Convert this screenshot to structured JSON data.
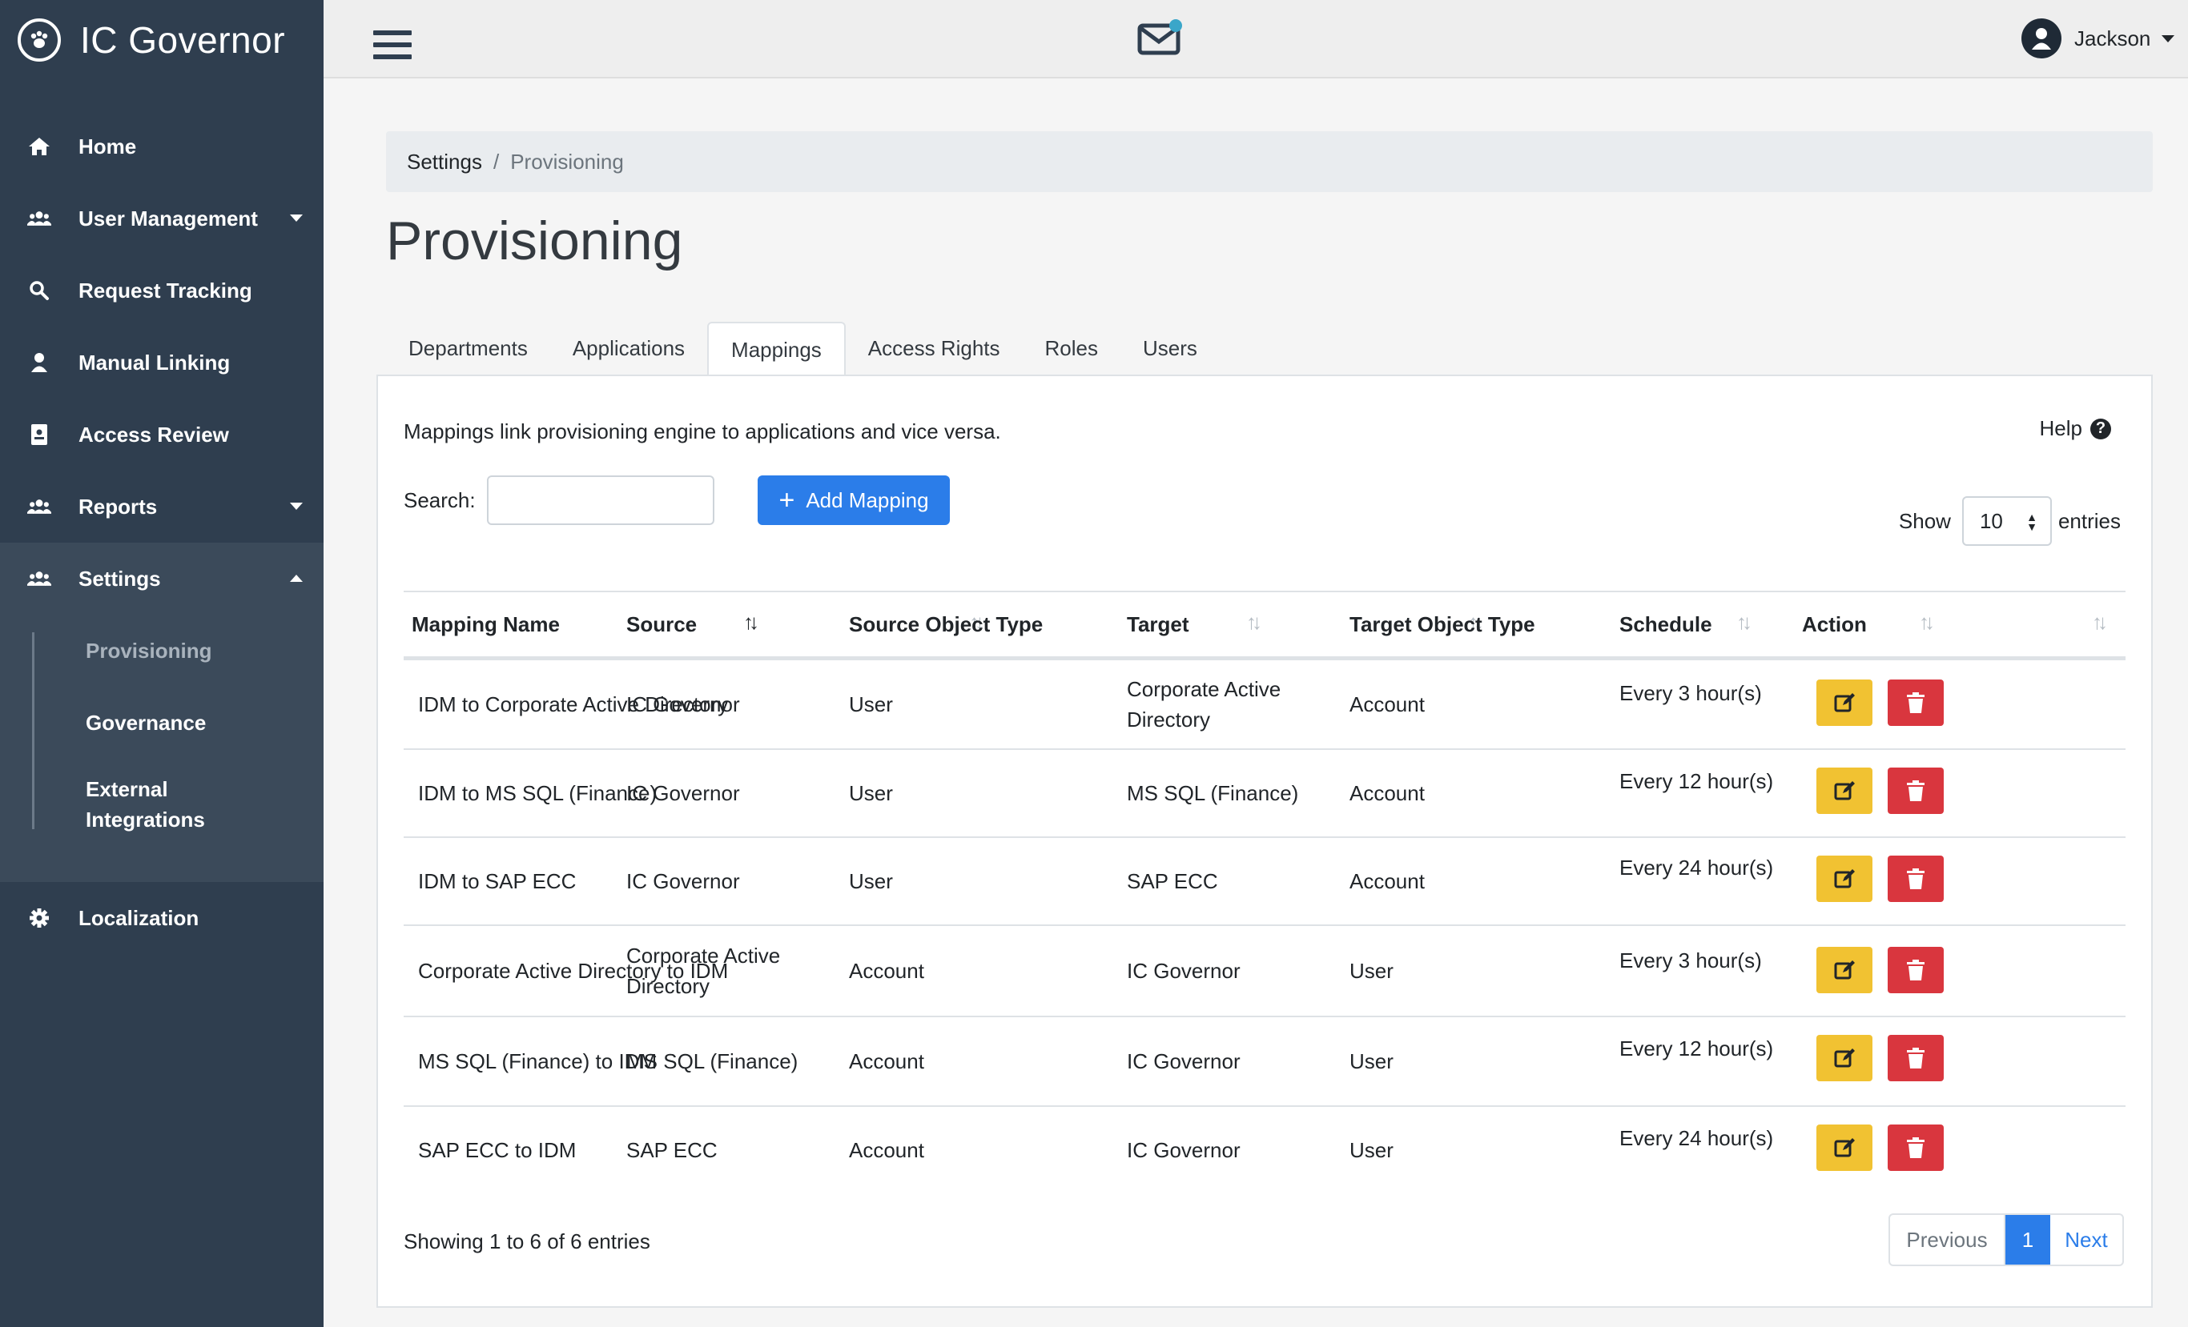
{
  "app": {
    "title": "IC Governor"
  },
  "sidebar": {
    "items": [
      {
        "label": "Home",
        "icon": "home-icon"
      },
      {
        "label": "User Management",
        "icon": "users-icon"
      },
      {
        "label": "Request Tracking",
        "icon": "search-icon"
      },
      {
        "label": "Manual Linking",
        "icon": "user-icon"
      },
      {
        "label": "Access Review",
        "icon": "id-badge-icon"
      },
      {
        "label": "Reports",
        "icon": "users-icon"
      },
      {
        "label": "Settings",
        "icon": "users-icon"
      },
      {
        "label": "Localization",
        "icon": "gear-icon"
      }
    ],
    "settings_sub": [
      "Provisioning",
      "Governance",
      "External",
      "Integrations"
    ]
  },
  "topbar": {
    "user_name": "Jackson",
    "mail_badge_color": "#3aa6c9"
  },
  "breadcrumb": {
    "parent": "Settings",
    "separator": "/",
    "current": "Provisioning"
  },
  "page": {
    "title": "Provisioning"
  },
  "tabs": [
    "Departments",
    "Applications",
    "Mappings",
    "Access Rights",
    "Roles",
    "Users"
  ],
  "panel": {
    "description": "Mappings link provisioning engine to applications and vice versa.",
    "help_label": "Help",
    "search_label": "Search:",
    "search_value": "",
    "add_button": "Add Mapping",
    "show_label": "Show",
    "show_value": "10",
    "entries_label": "entries"
  },
  "table": {
    "headers": [
      "Mapping Name",
      "Source",
      "Source Object Type",
      "Target",
      "Target Object Type",
      "Schedule",
      "Action"
    ],
    "rows": [
      [
        "IDM to Corporate Active Directory",
        "IC Governor",
        "User",
        "Corporate Active Directory",
        "Account",
        "Every 3 hour(s)"
      ],
      [
        "IDM to MS SQL (Finance)",
        "IC Governor",
        "User",
        "MS SQL (Finance)",
        "Account",
        "Every 12 hour(s)"
      ],
      [
        "IDM to SAP ECC",
        "IC Governor",
        "User",
        "SAP ECC",
        "Account",
        "Every 24 hour(s)"
      ],
      [
        "Corporate Active Directory to IDM",
        "Corporate Active Directory",
        "Account",
        "IC Governor",
        "User",
        "Every 3 hour(s)"
      ],
      [
        "MS SQL (Finance) to IDM",
        "MS SQL (Finance)",
        "Account",
        "IC Governor",
        "User",
        "Every 12 hour(s)"
      ],
      [
        "SAP ECC to IDM",
        "SAP ECC",
        "Account",
        "IC Governor",
        "User",
        "Every 24 hour(s)"
      ]
    ]
  },
  "footer": {
    "showing": "Showing 1 to 6 of 6 entries",
    "prev": "Previous",
    "page": "1",
    "next": "Next"
  },
  "colors": {
    "sidebar": "#2f3e4f",
    "primary": "#2b7de9",
    "edit": "#f1c232",
    "delete": "#d9363e"
  }
}
